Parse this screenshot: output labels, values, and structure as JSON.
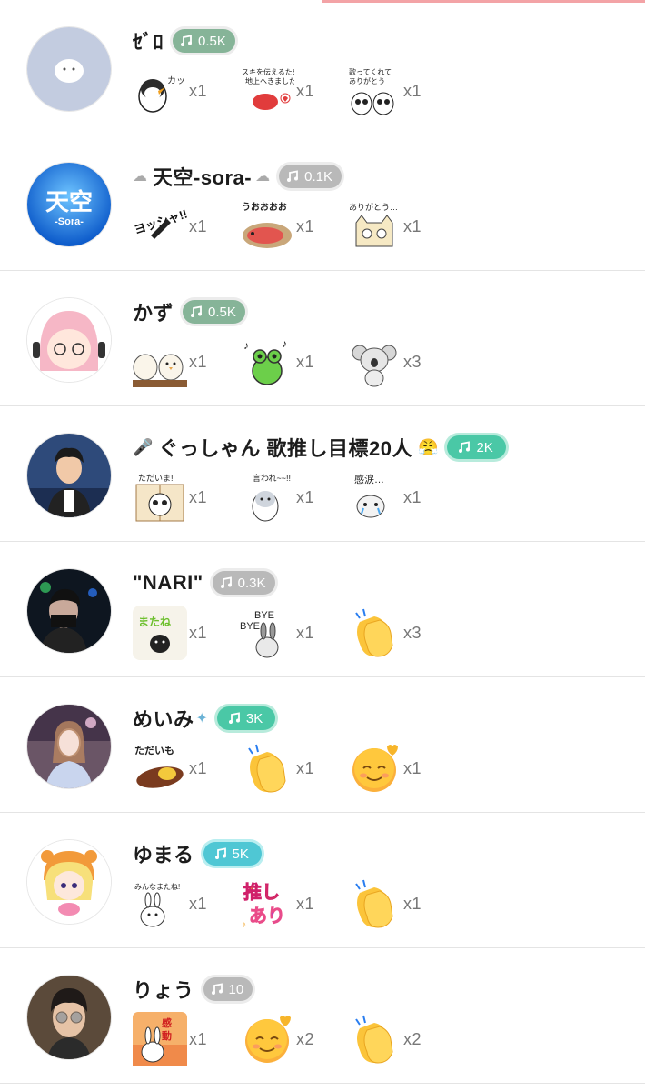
{
  "viewers": [
    {
      "name": "ｾﾞﾛ",
      "level": "0.5K",
      "gifts": [
        {
          "sticker": "penguin-sticker",
          "caption": "かっこいい~",
          "count": "x1"
        },
        {
          "sticker": "red-bird-sticker",
          "caption": "スキを伝えるため地上へきました",
          "count": "x1"
        },
        {
          "sticker": "panda-pair-sticker",
          "caption": "歌ってくれてありがとう",
          "count": "x1"
        }
      ]
    },
    {
      "name": "天空-sora-",
      "level": "0.1K",
      "avatar_text": "天空",
      "avatar_subtext": "-Sora-",
      "gifts": [
        {
          "sticker": "yosshya-sticker",
          "caption": "ヨッシャ!!",
          "count": "x1"
        },
        {
          "sticker": "fish-sticker",
          "caption": "うおおおお",
          "count": "x1"
        },
        {
          "sticker": "cat-thanks-sticker",
          "caption": "ありがとう…",
          "count": "x1"
        }
      ]
    },
    {
      "name": "かず",
      "level": "0.5K",
      "gifts": [
        {
          "sticker": "bird-sticker",
          "caption": "",
          "count": "x1"
        },
        {
          "sticker": "frog-sticker",
          "caption": "",
          "count": "x1"
        },
        {
          "sticker": "koala-sticker",
          "caption": "",
          "count": "x3"
        }
      ]
    },
    {
      "name": "ぐっしゃん 歌推し目標20人",
      "level": "2K",
      "gifts": [
        {
          "sticker": "panda-window-sticker",
          "caption": "ただいま!",
          "count": "x1"
        },
        {
          "sticker": "penguin-sticker",
          "caption": "言われ~~!!",
          "count": "x1"
        },
        {
          "sticker": "crying-cat-sticker",
          "caption": "感涙…",
          "count": "x1"
        }
      ]
    },
    {
      "name": "\"NARI\"",
      "level": "0.3K",
      "gifts": [
        {
          "sticker": "matane-sticker",
          "caption": "でぃまたね",
          "count": "x1"
        },
        {
          "sticker": "bye-rabbit-sticker",
          "caption": "BYE BYE",
          "count": "x1"
        },
        {
          "sticker": "clap-emoji",
          "caption": "",
          "count": "x3"
        }
      ]
    },
    {
      "name": "めいみ",
      "level": "3K",
      "gifts": [
        {
          "sticker": "sweet-potato-sticker",
          "caption": "ただいも",
          "count": "x1"
        },
        {
          "sticker": "clap-emoji",
          "caption": "",
          "count": "x1"
        },
        {
          "sticker": "smile-emoji",
          "caption": "",
          "count": "x1"
        }
      ]
    },
    {
      "name": "ゆまる",
      "level": "5K",
      "gifts": [
        {
          "sticker": "rabbit-sticker",
          "caption": "みんなまたね!",
          "count": "x1"
        },
        {
          "sticker": "oshi-ari-sticker",
          "caption": "推しあり",
          "count": "x1"
        },
        {
          "sticker": "clap-emoji",
          "caption": "",
          "count": "x1"
        }
      ]
    },
    {
      "name": "りょう",
      "level": "10",
      "gifts": [
        {
          "sticker": "kandou-rabbit-sticker",
          "caption": "感動",
          "count": "x1"
        },
        {
          "sticker": "smile-emoji",
          "caption": "",
          "count": "x2"
        },
        {
          "sticker": "clap-emoji",
          "caption": "",
          "count": "x2"
        }
      ]
    }
  ],
  "colors": {
    "green": "#86b498",
    "gray": "#b9b9b9",
    "teal": "#4ac8a6",
    "cyan": "#4fc7d4",
    "accent_bar": "#f3a3a6"
  }
}
